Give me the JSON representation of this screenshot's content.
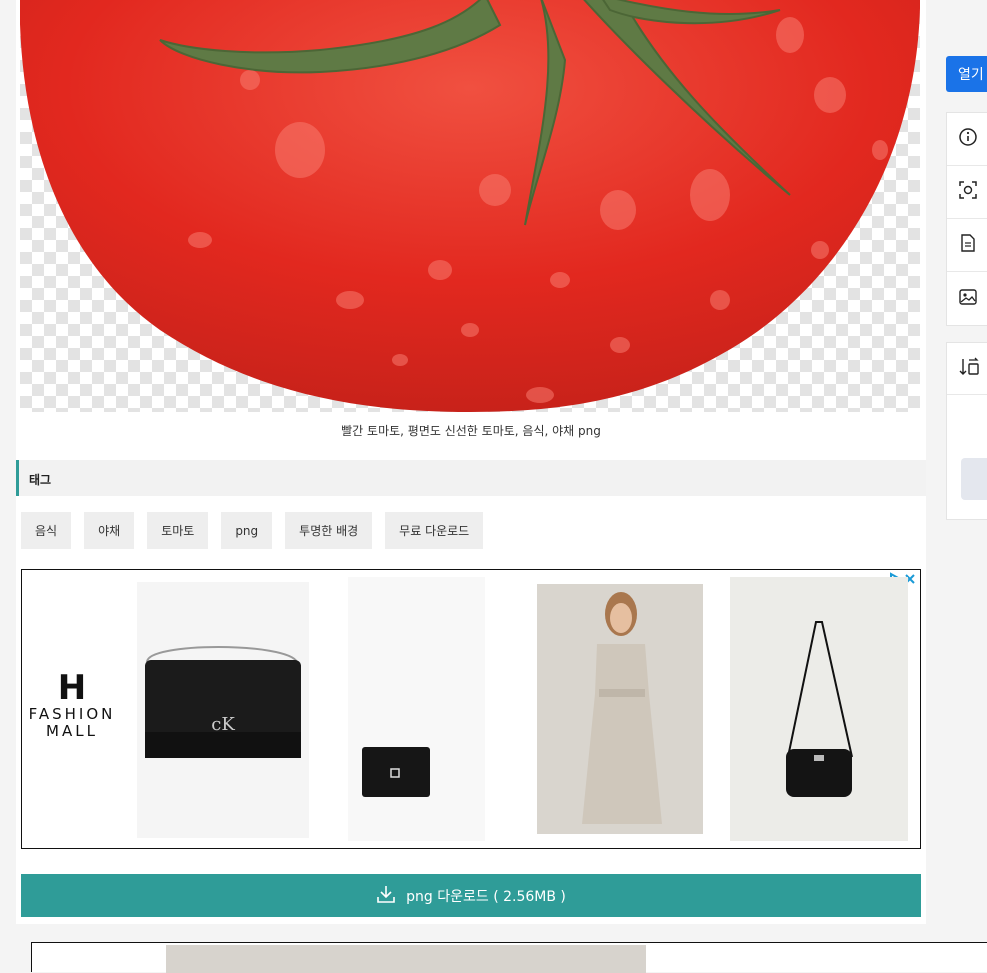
{
  "caption": "빨간 토마토, 평면도 신선한 토마토, 음식, 야채 png",
  "tags_header": "태그",
  "tags": [
    "음식",
    "야채",
    "토마토",
    "png",
    "투명한 배경",
    "무료 다운로드"
  ],
  "ad": {
    "logo_letter": "H",
    "logo_line1": "FASHION",
    "logo_line2": "MALL",
    "choice_icon": "adchoices-icon"
  },
  "download_label": "png 다운로드 ( 2.56MB )",
  "right_panel": {
    "open_label": "열기",
    "icons": [
      "info-icon",
      "scan-icon",
      "document-icon",
      "image-icon"
    ],
    "bottom_icon": "sort-icon"
  },
  "colors": {
    "accent": "#2f9c98",
    "open_button": "#1a73e8",
    "tomato": "#e8302a"
  }
}
